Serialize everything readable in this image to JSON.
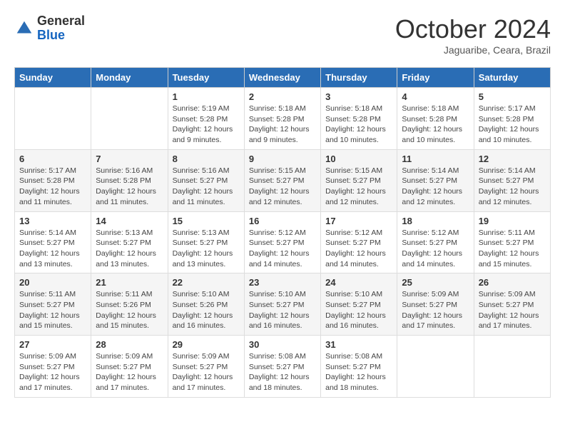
{
  "header": {
    "logo_general": "General",
    "logo_blue": "Blue",
    "month_title": "October 2024",
    "location": "Jaguaribe, Ceara, Brazil"
  },
  "days_of_week": [
    "Sunday",
    "Monday",
    "Tuesday",
    "Wednesday",
    "Thursday",
    "Friday",
    "Saturday"
  ],
  "weeks": [
    [
      {
        "day": "",
        "content": ""
      },
      {
        "day": "",
        "content": ""
      },
      {
        "day": "1",
        "content": "Sunrise: 5:19 AM\nSunset: 5:28 PM\nDaylight: 12 hours\nand 9 minutes."
      },
      {
        "day": "2",
        "content": "Sunrise: 5:18 AM\nSunset: 5:28 PM\nDaylight: 12 hours\nand 9 minutes."
      },
      {
        "day": "3",
        "content": "Sunrise: 5:18 AM\nSunset: 5:28 PM\nDaylight: 12 hours\nand 10 minutes."
      },
      {
        "day": "4",
        "content": "Sunrise: 5:18 AM\nSunset: 5:28 PM\nDaylight: 12 hours\nand 10 minutes."
      },
      {
        "day": "5",
        "content": "Sunrise: 5:17 AM\nSunset: 5:28 PM\nDaylight: 12 hours\nand 10 minutes."
      }
    ],
    [
      {
        "day": "6",
        "content": "Sunrise: 5:17 AM\nSunset: 5:28 PM\nDaylight: 12 hours\nand 11 minutes."
      },
      {
        "day": "7",
        "content": "Sunrise: 5:16 AM\nSunset: 5:28 PM\nDaylight: 12 hours\nand 11 minutes."
      },
      {
        "day": "8",
        "content": "Sunrise: 5:16 AM\nSunset: 5:27 PM\nDaylight: 12 hours\nand 11 minutes."
      },
      {
        "day": "9",
        "content": "Sunrise: 5:15 AM\nSunset: 5:27 PM\nDaylight: 12 hours\nand 12 minutes."
      },
      {
        "day": "10",
        "content": "Sunrise: 5:15 AM\nSunset: 5:27 PM\nDaylight: 12 hours\nand 12 minutes."
      },
      {
        "day": "11",
        "content": "Sunrise: 5:14 AM\nSunset: 5:27 PM\nDaylight: 12 hours\nand 12 minutes."
      },
      {
        "day": "12",
        "content": "Sunrise: 5:14 AM\nSunset: 5:27 PM\nDaylight: 12 hours\nand 12 minutes."
      }
    ],
    [
      {
        "day": "13",
        "content": "Sunrise: 5:14 AM\nSunset: 5:27 PM\nDaylight: 12 hours\nand 13 minutes."
      },
      {
        "day": "14",
        "content": "Sunrise: 5:13 AM\nSunset: 5:27 PM\nDaylight: 12 hours\nand 13 minutes."
      },
      {
        "day": "15",
        "content": "Sunrise: 5:13 AM\nSunset: 5:27 PM\nDaylight: 12 hours\nand 13 minutes."
      },
      {
        "day": "16",
        "content": "Sunrise: 5:12 AM\nSunset: 5:27 PM\nDaylight: 12 hours\nand 14 minutes."
      },
      {
        "day": "17",
        "content": "Sunrise: 5:12 AM\nSunset: 5:27 PM\nDaylight: 12 hours\nand 14 minutes."
      },
      {
        "day": "18",
        "content": "Sunrise: 5:12 AM\nSunset: 5:27 PM\nDaylight: 12 hours\nand 14 minutes."
      },
      {
        "day": "19",
        "content": "Sunrise: 5:11 AM\nSunset: 5:27 PM\nDaylight: 12 hours\nand 15 minutes."
      }
    ],
    [
      {
        "day": "20",
        "content": "Sunrise: 5:11 AM\nSunset: 5:27 PM\nDaylight: 12 hours\nand 15 minutes."
      },
      {
        "day": "21",
        "content": "Sunrise: 5:11 AM\nSunset: 5:26 PM\nDaylight: 12 hours\nand 15 minutes."
      },
      {
        "day": "22",
        "content": "Sunrise: 5:10 AM\nSunset: 5:26 PM\nDaylight: 12 hours\nand 16 minutes."
      },
      {
        "day": "23",
        "content": "Sunrise: 5:10 AM\nSunset: 5:27 PM\nDaylight: 12 hours\nand 16 minutes."
      },
      {
        "day": "24",
        "content": "Sunrise: 5:10 AM\nSunset: 5:27 PM\nDaylight: 12 hours\nand 16 minutes."
      },
      {
        "day": "25",
        "content": "Sunrise: 5:09 AM\nSunset: 5:27 PM\nDaylight: 12 hours\nand 17 minutes."
      },
      {
        "day": "26",
        "content": "Sunrise: 5:09 AM\nSunset: 5:27 PM\nDaylight: 12 hours\nand 17 minutes."
      }
    ],
    [
      {
        "day": "27",
        "content": "Sunrise: 5:09 AM\nSunset: 5:27 PM\nDaylight: 12 hours\nand 17 minutes."
      },
      {
        "day": "28",
        "content": "Sunrise: 5:09 AM\nSunset: 5:27 PM\nDaylight: 12 hours\nand 17 minutes."
      },
      {
        "day": "29",
        "content": "Sunrise: 5:09 AM\nSunset: 5:27 PM\nDaylight: 12 hours\nand 17 minutes."
      },
      {
        "day": "30",
        "content": "Sunrise: 5:08 AM\nSunset: 5:27 PM\nDaylight: 12 hours\nand 18 minutes."
      },
      {
        "day": "31",
        "content": "Sunrise: 5:08 AM\nSunset: 5:27 PM\nDaylight: 12 hours\nand 18 minutes."
      },
      {
        "day": "",
        "content": ""
      },
      {
        "day": "",
        "content": ""
      }
    ]
  ]
}
